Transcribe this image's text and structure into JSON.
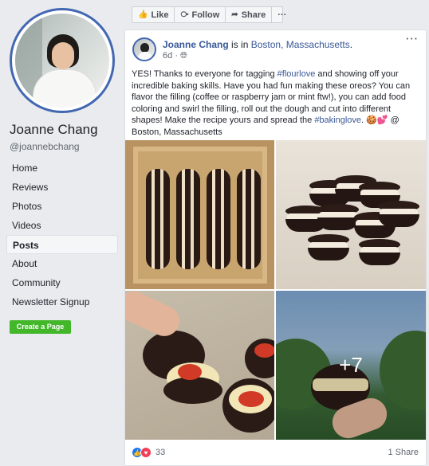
{
  "profile": {
    "name": "Joanne Chang",
    "handle": "@joannebchang"
  },
  "nav": [
    {
      "label": "Home"
    },
    {
      "label": "Reviews"
    },
    {
      "label": "Photos"
    },
    {
      "label": "Videos"
    },
    {
      "label": "Posts",
      "active": true
    },
    {
      "label": "About"
    },
    {
      "label": "Community"
    },
    {
      "label": "Newsletter Signup"
    }
  ],
  "create_page_label": "Create a Page",
  "actions": {
    "like": "Like",
    "follow": "Follow",
    "share": "Share",
    "more": "···"
  },
  "post": {
    "author": "Joanne Chang",
    "is_in": " is in ",
    "location": "Boston, Massachusetts",
    "location_suffix": ".",
    "time": "6d",
    "menu": "···",
    "text_1": "YES! Thanks to everyone for tagging ",
    "hashtag_1": "#flourlove",
    "text_2": " and showing off your incredible baking skills. Have you had fun making these oreos? You can flavor the filling (coffee or raspberry jam or mint ftw!), you can add food coloring and swirl the filling, roll out the dough and cut into different shapes! Make the recipe yours and spread the ",
    "hashtag_2": "#bakinglove",
    "text_3": ". 🍪💕 @ Boston, Massachusetts",
    "more_photos": "+7",
    "reaction_count": "33",
    "shares": "1 Share"
  },
  "icons": {
    "like": "thumbs-up-icon",
    "follow": "rss-icon",
    "share": "share-arrow-icon",
    "globe": "globe-icon"
  },
  "colors": {
    "link": "#385898",
    "accent": "#4267b2",
    "create_button": "#42b72a",
    "background": "#e9ebee"
  }
}
